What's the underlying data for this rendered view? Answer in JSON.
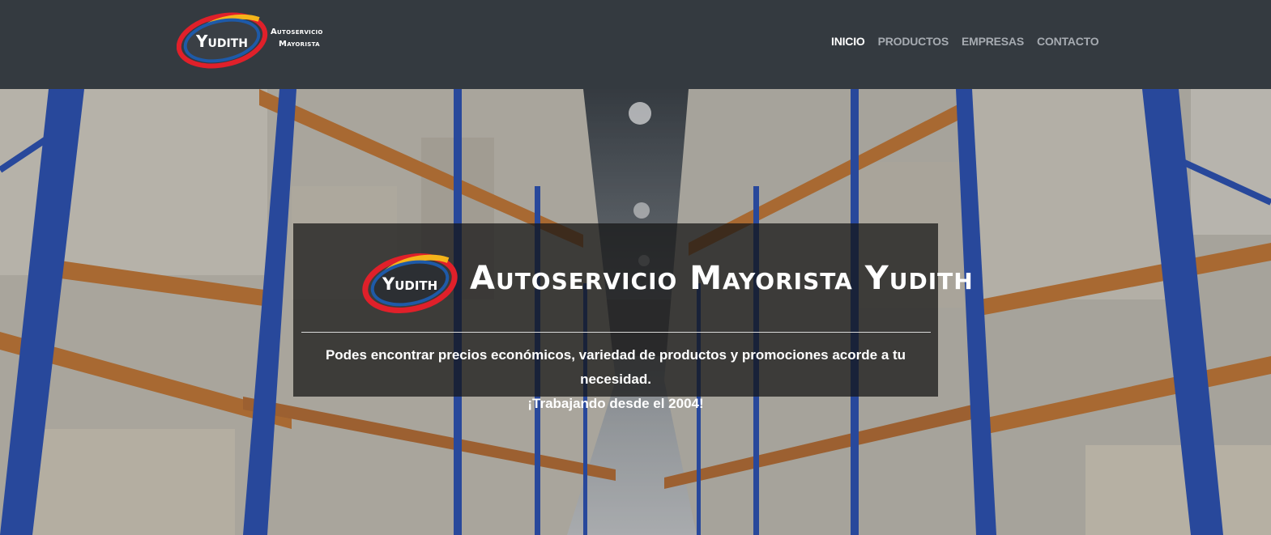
{
  "brand": {
    "logo_word": "Yudith",
    "line1": "Autoservicio",
    "line2": "Mayorista"
  },
  "nav": {
    "items": [
      {
        "label": "INICIO",
        "active": true
      },
      {
        "label": "PRODUCTOS",
        "active": false
      },
      {
        "label": "EMPRESAS",
        "active": false
      },
      {
        "label": "CONTACTO",
        "active": false
      }
    ]
  },
  "hero": {
    "logo_word": "Yudith",
    "title": "Autoservicio Mayorista Yudith",
    "line1": "Podes encontrar precios económicos, variedad de productos y promociones acorde a tu necesidad.",
    "line2": "¡Trabajando desde el 2004!"
  },
  "colors": {
    "header_bg": "#343a40",
    "nav_active": "#ffffff",
    "nav_inactive": "#a6abb1",
    "logo_red": "#e0202a",
    "logo_yellow": "#f4b41a",
    "logo_blue": "#1e5aa8",
    "rack_blue": "#2b52b6",
    "beam_orange": "#c77a36"
  }
}
